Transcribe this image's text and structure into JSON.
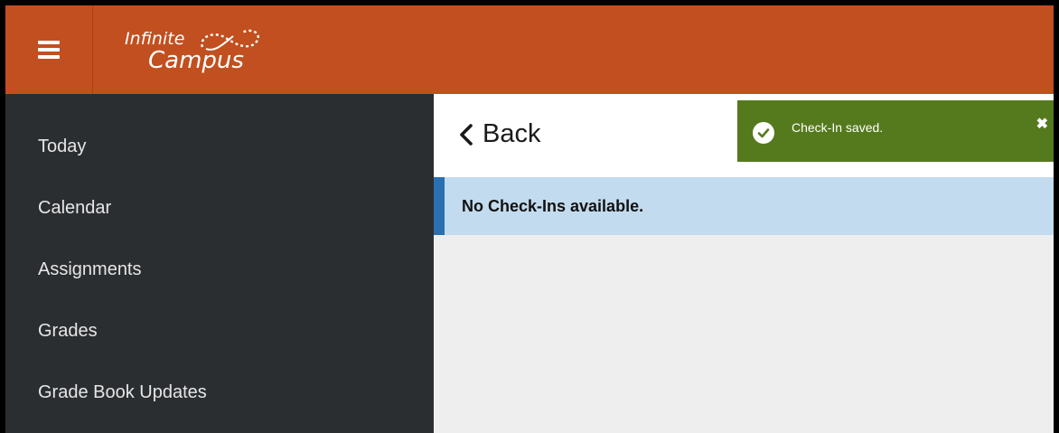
{
  "header": {
    "logo_line1": "Infinite",
    "logo_line2": "Campus",
    "bar_color": "#c24f1f"
  },
  "sidebar": {
    "items": [
      {
        "label": "Today"
      },
      {
        "label": "Calendar"
      },
      {
        "label": "Assignments"
      },
      {
        "label": "Grades"
      },
      {
        "label": "Grade Book Updates"
      }
    ]
  },
  "main": {
    "back_label": "Back",
    "notice_text": "No Check-Ins available."
  },
  "toast": {
    "message": "Check-In saved.",
    "close_glyph": "✖",
    "color": "#557a1e"
  },
  "icons": [
    "hamburger-menu-icon",
    "infinity-logo-icon",
    "chevron-left-icon",
    "check-circle-icon",
    "close-icon"
  ]
}
